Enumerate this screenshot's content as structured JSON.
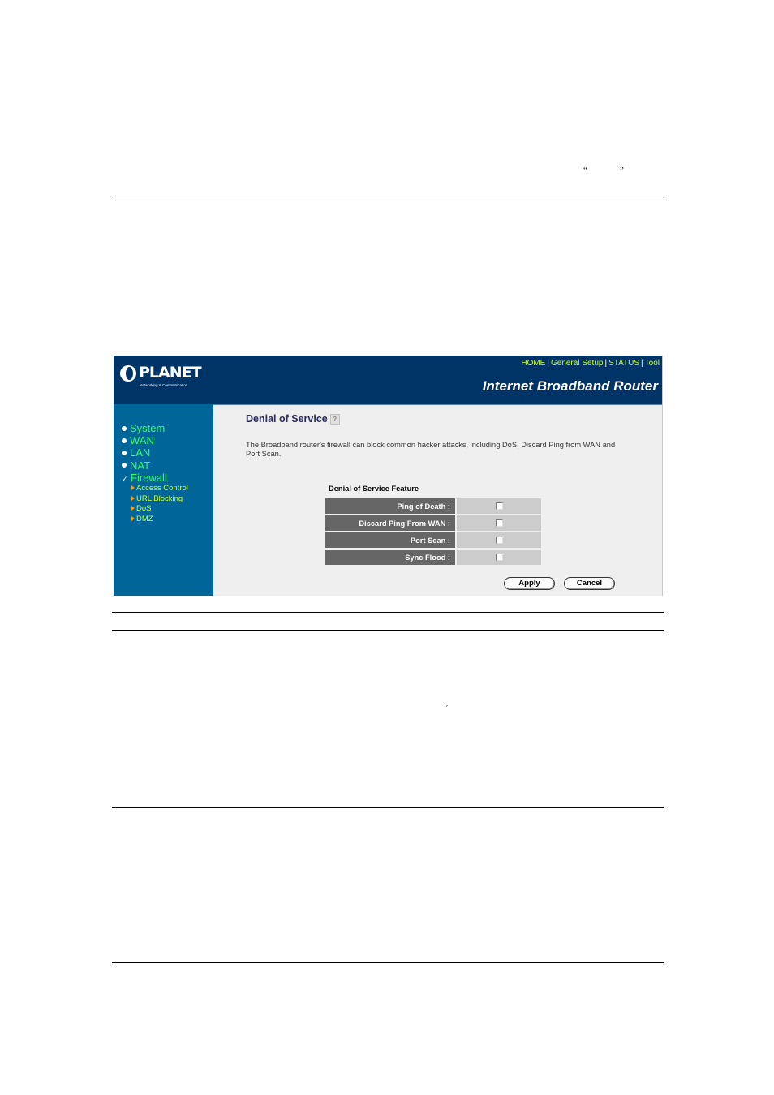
{
  "document": {
    "marks": {
      "open_quote": "“",
      "close_quote": "”",
      "apostrophe": "’"
    }
  },
  "router": {
    "logo": {
      "name": "PLANET",
      "tagline": "Networking & Communication"
    },
    "topnav": [
      "HOME",
      "General Setup",
      "STATUS",
      "Tool"
    ],
    "product_title": "Internet Broadband Router",
    "sidebar": {
      "items": [
        {
          "label": "System",
          "icon": "bullet-icon"
        },
        {
          "label": "WAN",
          "icon": "bullet-icon"
        },
        {
          "label": "LAN",
          "icon": "bullet-icon"
        },
        {
          "label": "NAT",
          "icon": "bullet-icon"
        },
        {
          "label": "Firewall",
          "icon": "check-icon"
        }
      ],
      "subitems": [
        "Access Control",
        "URL Blocking",
        "DoS",
        "DMZ"
      ]
    },
    "page": {
      "title": "Denial of Service",
      "description": "The Broadband router's firewall can block common hacker attacks, including DoS, Discard Ping from WAN and Port Scan.",
      "feature_heading": "Denial of Service Feature",
      "features": [
        {
          "label": "Ping of Death :",
          "checked": false
        },
        {
          "label": "Discard Ping From WAN :",
          "checked": false
        },
        {
          "label": "Port Scan :",
          "checked": false
        },
        {
          "label": "Sync Flood :",
          "checked": false
        }
      ],
      "buttons": {
        "apply": "Apply",
        "cancel": "Cancel"
      }
    }
  }
}
